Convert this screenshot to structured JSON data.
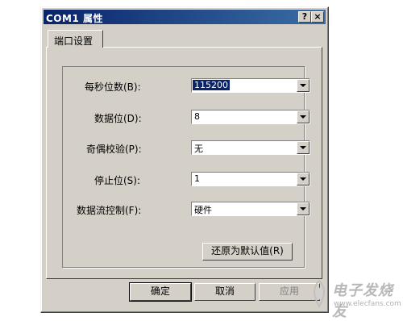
{
  "window": {
    "title": "COM1 属性",
    "help_label": "?",
    "close_label": "×"
  },
  "tab": {
    "label": "端口设置"
  },
  "fields": [
    {
      "label": "每秒位数(B):",
      "value": "115200"
    },
    {
      "label": "数据位(D):",
      "value": "8"
    },
    {
      "label": "奇偶校验(P):",
      "value": "无"
    },
    {
      "label": "停止位(S):",
      "value": "1"
    },
    {
      "label": "数据流控制(F):",
      "value": "硬件"
    }
  ],
  "buttons": {
    "restore_defaults": "还原为默认值(R)",
    "ok": "确定",
    "cancel": "取消",
    "apply": "应用"
  },
  "watermark": {
    "title": "电子发烧友",
    "url": "www.elecfans.com"
  }
}
